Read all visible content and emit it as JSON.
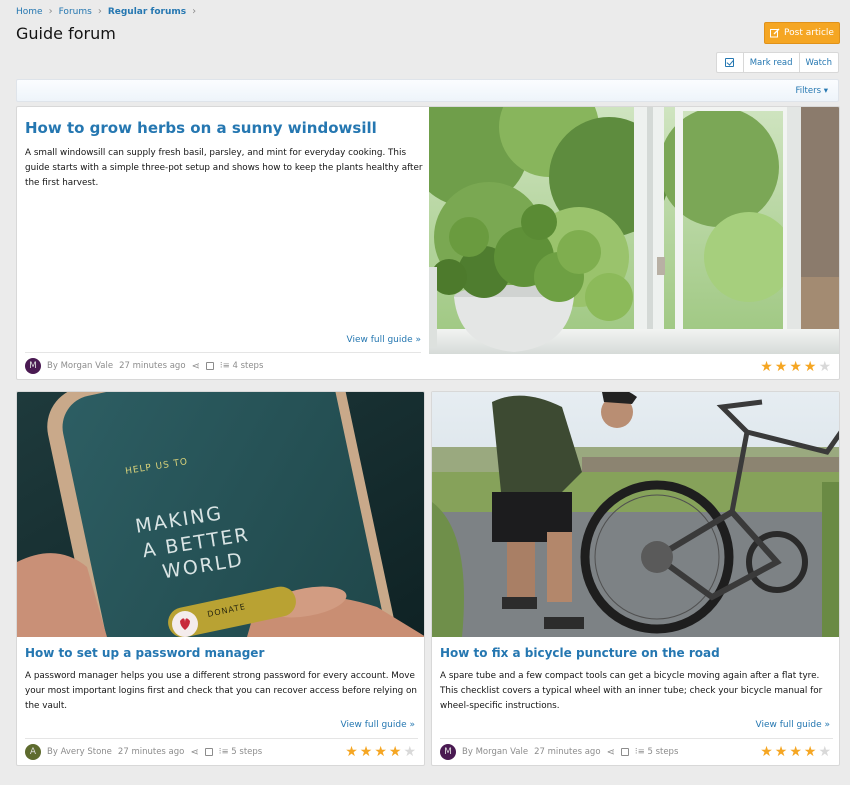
{
  "breadcrumb": {
    "items": [
      "Home",
      "Forums",
      "Regular forums"
    ]
  },
  "page": {
    "title": "Guide forum",
    "post_button": "Post article"
  },
  "actions": {
    "mark_read": "Mark read",
    "watch": "Watch"
  },
  "filters": {
    "label": "Filters"
  },
  "guides": [
    {
      "title": "How to grow herbs on a sunny windowsill",
      "description": "A small windowsill can supply fresh basil, parsley, and mint for everyday cooking. This guide starts with a simple three-pot setup and shows how to keep the plants healthy after the first harvest.",
      "view_link": "View full guide »",
      "author": "By Morgan Vale",
      "avatar_letter": "M",
      "avatar_color": "#4a1a52",
      "time": "27 minutes ago",
      "steps": "4 steps",
      "rating": 4,
      "rating_max": 5
    },
    {
      "title": "How to set up a password manager",
      "description": "A password manager helps you use a different strong password for every account. Move your most important logins first and check that you can recover access before relying on the vault.",
      "view_link": "View full guide »",
      "author": "By Avery Stone",
      "avatar_letter": "A",
      "avatar_color": "#5e6b2e",
      "time": "27 minutes ago",
      "steps": "5 steps",
      "rating": 4,
      "rating_max": 5,
      "image_text": {
        "small": "HELP US TO",
        "line1": "MAKING",
        "line2": "A BETTER",
        "line3": "WORLD",
        "button": "DONATE"
      }
    },
    {
      "title": "How to fix a bicycle puncture on the road",
      "description": "A spare tube and a few compact tools can get a bicycle moving again after a flat tyre. This checklist covers a typical wheel with an inner tube; check your bicycle manual for wheel-specific instructions.",
      "view_link": "View full guide »",
      "author": "By Morgan Vale",
      "avatar_letter": "M",
      "avatar_color": "#4a1a52",
      "time": "27 minutes ago",
      "steps": "5 steps",
      "rating": 4,
      "rating_max": 5
    }
  ],
  "colors": {
    "accent": "#2577b1",
    "button_orange": "#f5a623",
    "star_filled": "#f5a623",
    "star_empty": "#d9d9d9"
  }
}
